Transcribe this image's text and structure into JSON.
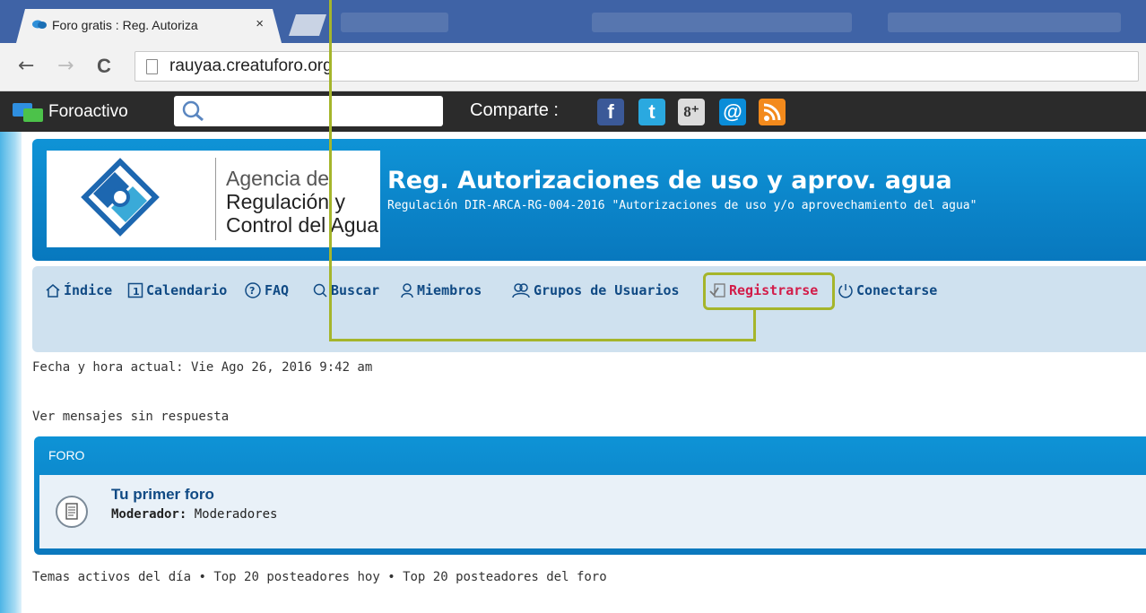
{
  "browser": {
    "tab_title": "Foro gratis : Reg. Autoriza",
    "tab_close": "×",
    "url": "rauyaa.creatuforo.org",
    "back": "←",
    "forward": "→",
    "reload": "C"
  },
  "toolbar": {
    "brand": "Foroactivo",
    "search_placeholder": "",
    "share_label": "Comparte :",
    "social": [
      {
        "name": "facebook",
        "glyph": "f",
        "color": "#3b5998"
      },
      {
        "name": "twitter",
        "glyph": "t",
        "color": "#2aa9e0"
      },
      {
        "name": "google-plus",
        "glyph": "8⁺",
        "color": "#dcdcdc"
      },
      {
        "name": "email",
        "glyph": "@",
        "color": "#0a8dd8"
      },
      {
        "name": "rss",
        "glyph": "",
        "color": "#f38a1c"
      }
    ]
  },
  "logo": {
    "line1": "Agencia de",
    "line2": "Regulación y",
    "line3": "Control del Agua"
  },
  "site": {
    "title": "Reg. Autorizaciones de uso y aprov. agua",
    "subtitle": "Regulación DIR-ARCA-RG-004-2016 \"Autorizaciones de uso y/o aprovechamiento del agua\""
  },
  "nav": {
    "indice": "Índice",
    "calendario": "Calendario",
    "faq": "FAQ",
    "buscar": "Buscar",
    "miembros": "Miembros",
    "grupos": "Grupos de Usuarios",
    "registrarse": "Registrarse",
    "conectarse": "Conectarse"
  },
  "status": {
    "datetime": "Fecha y hora actual: Vie Ago 26, 2016 9:42 am",
    "unanswered": "Ver mensajes sin respuesta"
  },
  "forum": {
    "header": "FORO",
    "title": "Tu primer foro",
    "mod_label": "Moderador:",
    "mod_value": "Moderadores"
  },
  "footer": {
    "link1": "Temas activos del día",
    "sep": "•",
    "link2": "Top 20 posteadores hoy",
    "link3": "Top 20 posteadores del foro"
  },
  "colors": {
    "highlight": "#a5b52b",
    "header_blue": "#0f93d6",
    "nav_link": "#104a84",
    "register_link": "#d21c49"
  }
}
